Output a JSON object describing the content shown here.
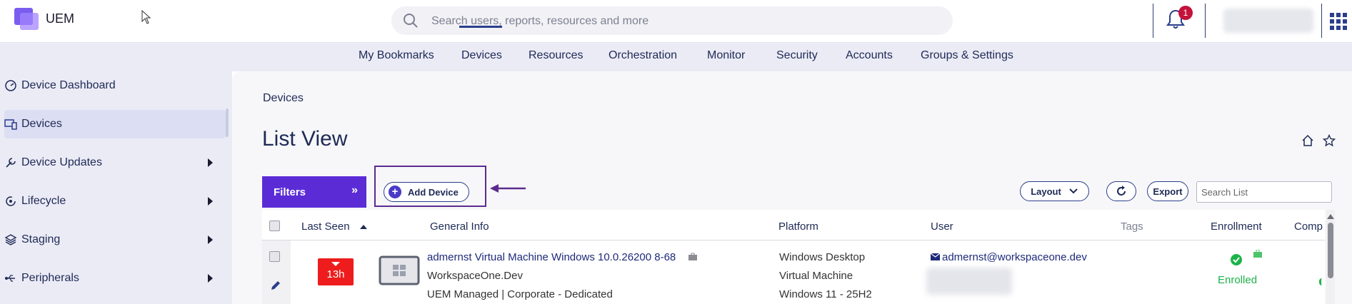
{
  "app": {
    "title": "UEM"
  },
  "search": {
    "placeholder": "Search users, reports, resources and more"
  },
  "notifications": {
    "count": "1"
  },
  "nav": {
    "items": [
      "My Bookmarks",
      "Devices",
      "Resources",
      "Orchestration",
      "Monitor",
      "Security",
      "Accounts",
      "Groups & Settings"
    ],
    "active": "Devices"
  },
  "sidebar": {
    "items": [
      {
        "label": "Device Dashboard",
        "icon": "dashboard-icon"
      },
      {
        "label": "Devices",
        "icon": "devices-icon",
        "active": true
      },
      {
        "label": "Device Updates",
        "icon": "wrench-icon"
      },
      {
        "label": "Lifecycle",
        "icon": "lifecycle-icon"
      },
      {
        "label": "Staging",
        "icon": "layers-icon"
      },
      {
        "label": "Peripherals",
        "icon": "usb-icon"
      }
    ]
  },
  "main": {
    "breadcrumb": "Devices",
    "title": "List View",
    "filters_label": "Filters",
    "add_device_label": "Add Device",
    "layout_label": "Layout",
    "export_label": "Export",
    "search_list_placeholder": "Search List"
  },
  "table": {
    "columns": [
      "Last Seen",
      "General Info",
      "Platform",
      "User",
      "Tags",
      "Enrollment",
      "Comp"
    ],
    "rows": [
      {
        "last_seen": "13h",
        "device_name": "admernst Virtual Machine Windows 10.0.26200 8-68",
        "org": "WorkspaceOne.Dev",
        "management": "UEM Managed | Corporate - Dedicated",
        "platform": [
          "Windows Desktop",
          "Virtual Machine",
          "Windows 11 - 25H2"
        ],
        "user_email": "admernst@workspaceone.dev",
        "enrollment": "Enrolled"
      }
    ]
  },
  "colors": {
    "accent": "#5b2cd6",
    "badge": "#c4123b",
    "last_seen_red": "#ee1c1c",
    "enrolled_green": "#1db34a"
  }
}
